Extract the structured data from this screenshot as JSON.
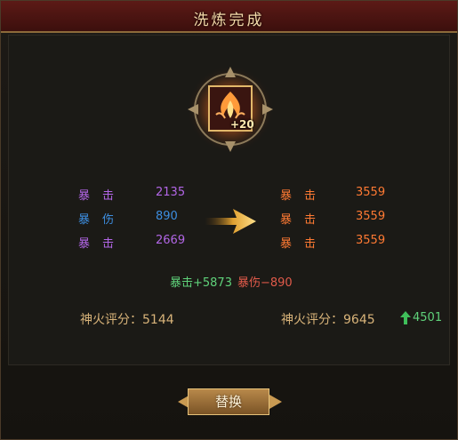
{
  "dialog": {
    "title": "洗炼完成"
  },
  "item": {
    "level_badge": "+20",
    "icon": "fire-crest-icon"
  },
  "before_stats": [
    {
      "name": "暴击",
      "value": "2135",
      "color": "#b266e6"
    },
    {
      "name": "暴伤",
      "value": "890",
      "color": "#3d8ee0"
    },
    {
      "name": "暴击",
      "value": "2669",
      "color": "#b266e6"
    }
  ],
  "after_stats": [
    {
      "name": "暴击",
      "value": "3559",
      "color": "#ff7a33"
    },
    {
      "name": "暴击",
      "value": "3559",
      "color": "#ff7a33"
    },
    {
      "name": "暴击",
      "value": "3559",
      "color": "#ff7a33"
    }
  ],
  "summary": {
    "gain": "暴击+5873",
    "loss": "暴伤−890"
  },
  "score_before": {
    "label": "神火评分：",
    "value": "5144"
  },
  "score_after": {
    "label": "神火评分：",
    "value": "9645",
    "delta": "4501"
  },
  "replace_button": {
    "label": "替换"
  }
}
